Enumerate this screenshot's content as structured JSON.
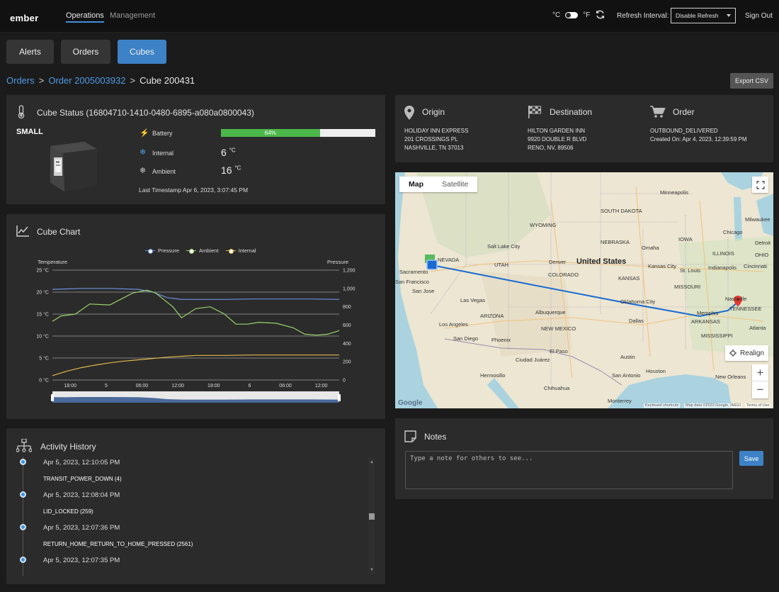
{
  "brand": "ember",
  "nav": {
    "links": [
      "Operations",
      "Management"
    ],
    "active_index": 0
  },
  "header": {
    "unit_c": "°C",
    "unit_f": "°F",
    "refresh_label": "Refresh Interval:",
    "refresh_value": "Disable Refresh",
    "sign_out": "Sign Out"
  },
  "tabs": [
    {
      "label": "Alerts",
      "active": false
    },
    {
      "label": "Orders",
      "active": false
    },
    {
      "label": "Cubes",
      "active": true
    }
  ],
  "breadcrumb": {
    "orders": "Orders",
    "order": "Order 2005003932",
    "current": "Cube 200431",
    "separator": ">"
  },
  "export_csv": "Export CSV",
  "cube_status": {
    "title": "Cube Status (16804710-1410-0480-6895-a080a0800043)",
    "size": "SMALL",
    "battery_label": "Battery",
    "battery_percent": 64,
    "battery_text": "64%",
    "internal_label": "Internal",
    "internal_value": "6",
    "ambient_label": "Ambient",
    "ambient_value": "16",
    "temp_unit": "°C",
    "last_timestamp": "Last Timestamp Apr 6, 2023, 3:07:45 PM"
  },
  "origin": {
    "title": "Origin",
    "lines": [
      "HOLIDAY INN EXPRESS",
      "201 CROSSINGS PL",
      "NASHVILLE, TN 37013"
    ]
  },
  "destination": {
    "title": "Destination",
    "lines": [
      "HILTON GARDEN INN",
      "9920 DOUBLE R BLVD",
      "RENO, NV, 89506"
    ]
  },
  "order": {
    "title": "Order",
    "lines": [
      "OUTBOUND_DELIVERED",
      "Created On: Apr 4, 2023, 12:39:59 PM"
    ]
  },
  "map": {
    "tab_map": "Map",
    "tab_satellite": "Satellite",
    "realign": "Realign",
    "zoom_in": "+",
    "zoom_out": "−",
    "google": "Google",
    "footer_shortcuts": "Keyboard shortcuts",
    "footer_data": "Map data ©2023 Google, INEGI",
    "footer_terms": "Terms of Use",
    "country_label": "United States",
    "labels": [
      "Minneapolis",
      "Chicago",
      "Milwaukee",
      "Detroit",
      "Indianapolis",
      "Cincinnati",
      "St. Louis",
      "Kansas City",
      "KANSAS",
      "MISSOURI",
      "Denver",
      "Salt Lake City",
      "NEVADA",
      "Sacramento",
      "San Francisco",
      "San Jose",
      "Las Vegas",
      "Los Angeles",
      "San Diego",
      "Phoenix",
      "ARIZONA",
      "Albuquerque",
      "NEW MEXICO",
      "Ciudad Juárez",
      "El Paso",
      "Dallas",
      "Austin",
      "Houston",
      "San Antonio",
      "Oklahoma City",
      "Memphis",
      "ARKANSAS",
      "MISSISSIPPI",
      "Nashville",
      "TENNESSEE",
      "Atlanta",
      "New Orleans",
      "IOWA",
      "NEBRASKA",
      "Omaha",
      "UTAH",
      "COLORADO",
      "WYOMING",
      "SOUTH DAKOTA",
      "ILLINOIS",
      "OHIO",
      "Chihuahua",
      "Hermosillo",
      "Monterrey"
    ]
  },
  "chart": {
    "title": "Cube Chart",
    "chart_data": {
      "type": "line",
      "title": "",
      "legend": [
        "Pressure",
        "Ambient",
        "Internal"
      ],
      "legend_position": "top-center",
      "ylabel_left": "Temperature",
      "ylabel_right": "Pressure",
      "y_left_ticks": [
        "0 °C",
        "5 °C",
        "10 °C",
        "15 °C",
        "20 °C",
        "25 °C"
      ],
      "y_left_range": [
        0,
        25
      ],
      "y_right_ticks": [
        "0",
        "200",
        "400",
        "600",
        "800",
        "1,000",
        "1,200"
      ],
      "y_right_range": [
        0,
        1200
      ],
      "x_ticks": [
        "18:00",
        "5",
        "06:00",
        "12:00",
        "18:00",
        "6",
        "06:00",
        "12:00"
      ],
      "x_range": [
        0,
        1
      ],
      "series": [
        {
          "name": "Pressure",
          "axis": "right",
          "color": "#6b8fe0",
          "x": [
            0,
            0.05,
            0.1,
            0.2,
            0.3,
            0.35,
            0.4,
            0.45,
            0.5,
            0.6,
            0.7,
            0.8,
            0.9,
            1.0
          ],
          "y": [
            990,
            995,
            1000,
            1000,
            990,
            960,
            900,
            880,
            880,
            880,
            885,
            885,
            885,
            880
          ]
        },
        {
          "name": "Ambient",
          "axis": "right",
          "color": "#9bd46a",
          "x": [
            0,
            0.03,
            0.08,
            0.13,
            0.2,
            0.28,
            0.33,
            0.36,
            0.38,
            0.42,
            0.45,
            0.5,
            0.55,
            0.6,
            0.64,
            0.68,
            0.72,
            0.78,
            0.84,
            0.88,
            0.92,
            0.96,
            1.0
          ],
          "y": [
            640,
            700,
            720,
            830,
            820,
            950,
            980,
            950,
            900,
            800,
            680,
            780,
            800,
            720,
            610,
            610,
            630,
            620,
            570,
            500,
            490,
            500,
            540
          ]
        },
        {
          "name": "Internal",
          "axis": "left",
          "color": "#e0b84a",
          "x": [
            0,
            0.05,
            0.1,
            0.15,
            0.2,
            0.25,
            0.3,
            0.35,
            0.4,
            0.45,
            0.5,
            0.6,
            0.7,
            0.8,
            0.9,
            1.0
          ],
          "y": [
            1.0,
            2.0,
            2.8,
            3.4,
            3.9,
            4.3,
            4.6,
            4.9,
            5.2,
            5.4,
            5.6,
            5.6,
            5.7,
            5.7,
            5.7,
            5.7
          ]
        }
      ]
    }
  },
  "activity": {
    "title": "Activity History",
    "items": [
      {
        "time": "Apr 5, 2023, 12:10:05 PM",
        "event": "TRANSIT_POWER_DOWN (4)"
      },
      {
        "time": "Apr 5, 2023, 12:08:04 PM",
        "event": "LID_LOCKED (259)"
      },
      {
        "time": "Apr 5, 2023, 12:07:36 PM",
        "event": "RETURN_HOME_RETURN_TO_HOME_PRESSED (2561)"
      },
      {
        "time": "Apr 5, 2023, 12:07:35 PM",
        "event": ""
      }
    ]
  },
  "notes": {
    "title": "Notes",
    "placeholder": "Type a note for others to see...",
    "save": "Save"
  },
  "colors": {
    "accent": "#3d82c6",
    "link": "#4f9be3",
    "battery": "#4cb84a",
    "panel": "#2b2b2b",
    "background": "#1b1b1b"
  }
}
